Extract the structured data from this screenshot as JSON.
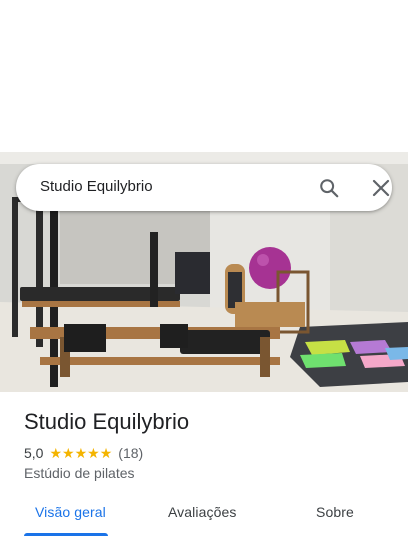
{
  "search": {
    "query": "Studio Equilybrio",
    "search_icon": "search-icon",
    "close_icon": "close-icon"
  },
  "photo": {
    "subject": "pilates-studio-interior"
  },
  "place": {
    "name": "Studio Equilybrio",
    "rating": "5,0",
    "stars": 5,
    "review_count": "(18)",
    "category": "Estúdio de pilates"
  },
  "tabs": [
    {
      "label": "Visão geral",
      "active": true
    },
    {
      "label": "Avaliações",
      "active": false
    },
    {
      "label": "Sobre",
      "active": false
    }
  ],
  "colors": {
    "accent": "#1a73e8",
    "star": "#f4b400",
    "text": "#202124",
    "secondary_text": "#5f6368"
  }
}
